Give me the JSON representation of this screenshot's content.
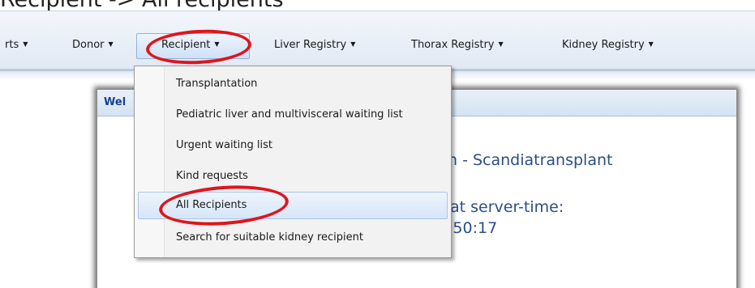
{
  "caption": "Recipient -> All recipients",
  "menubar": {
    "items": [
      {
        "label": "rts"
      },
      {
        "label": "Donor"
      },
      {
        "label": "Recipient"
      },
      {
        "label": "Liver Registry"
      },
      {
        "label": "Thorax Registry"
      },
      {
        "label": "Kidney Registry"
      }
    ],
    "active": "Recipient"
  },
  "dropdown": {
    "items": [
      {
        "label": "Transplantation"
      },
      {
        "label": "Pediatric liver and multivisceral waiting list"
      },
      {
        "label": "Urgent waiting list"
      },
      {
        "label": "Kind requests"
      },
      {
        "label": "All Recipients"
      },
      {
        "label": "Search for suitable kidney recipient"
      }
    ],
    "highlighted": "All Recipients"
  },
  "panel": {
    "title": "Wel",
    "line1": "n - Scandiatransplant",
    "line2": "at server-time:",
    "line3": ":50:17"
  },
  "colors": {
    "annotation": "#e0141c",
    "menubar": "#e6edf6",
    "panel_text": "#2a4f88"
  }
}
